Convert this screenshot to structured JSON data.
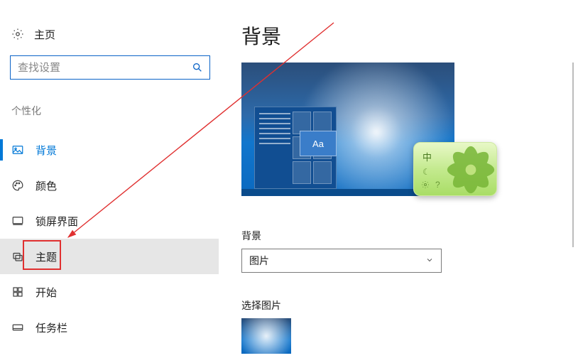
{
  "sidebar": {
    "home_label": "主页",
    "search_placeholder": "查找设置",
    "section_header": "个性化",
    "items": [
      {
        "label": "背景"
      },
      {
        "label": "颜色"
      },
      {
        "label": "锁屏界面"
      },
      {
        "label": "主题"
      },
      {
        "label": "开始"
      },
      {
        "label": "任务栏"
      }
    ]
  },
  "main": {
    "page_title": "背景",
    "preview_window_text": "Aa",
    "ime": {
      "zh_label": "中"
    },
    "background_field_label": "背景",
    "background_dropdown_value": "图片",
    "choose_picture_label": "选择图片"
  }
}
